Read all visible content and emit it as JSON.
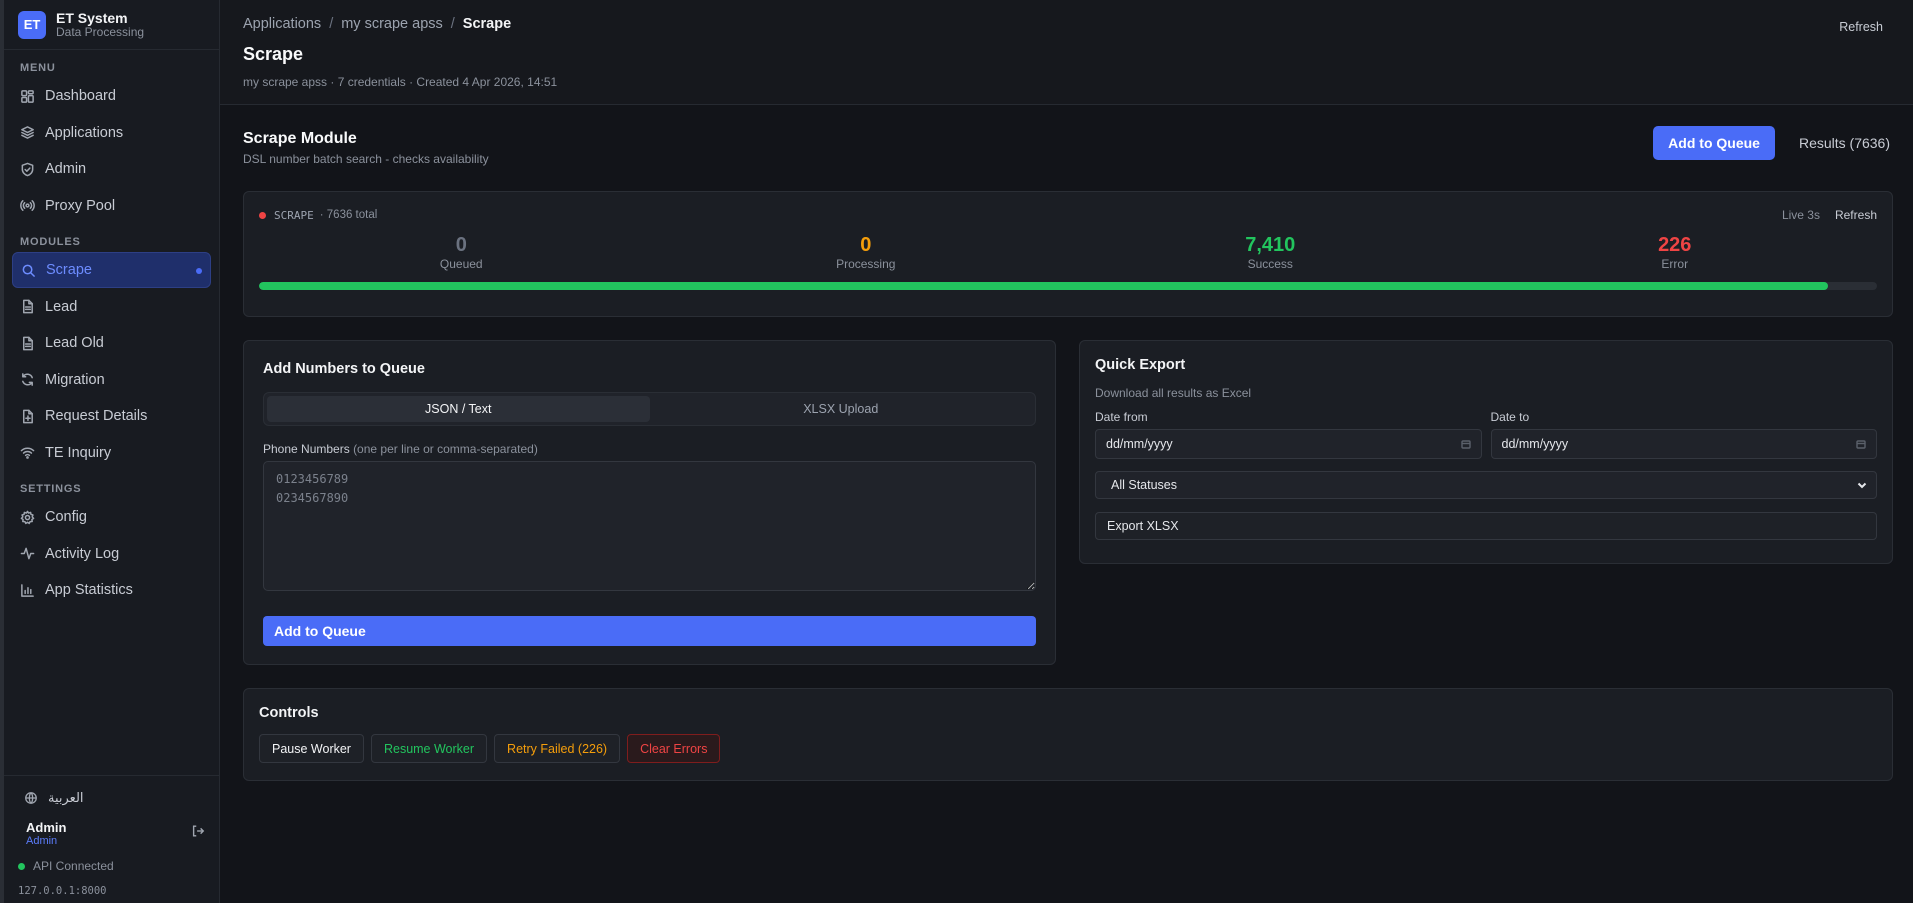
{
  "brand": {
    "logo": "ET",
    "title": "ET System",
    "subtitle": "Data Processing"
  },
  "sidebar": {
    "sections": {
      "menu": "MENU",
      "modules": "MODULES",
      "settings": "SETTINGS"
    },
    "menu_items": [
      {
        "label": "Dashboard",
        "icon": "grid-icon"
      },
      {
        "label": "Applications",
        "icon": "layers-icon"
      },
      {
        "label": "Admin",
        "icon": "shield-icon"
      },
      {
        "label": "Proxy Pool",
        "icon": "broadcast-icon"
      }
    ],
    "module_items": [
      {
        "label": "Scrape",
        "icon": "search-icon",
        "active": true
      },
      {
        "label": "Lead",
        "icon": "file-icon"
      },
      {
        "label": "Lead Old",
        "icon": "file-icon"
      },
      {
        "label": "Migration",
        "icon": "refresh-icon"
      },
      {
        "label": "Request Details",
        "icon": "file-plus-icon"
      },
      {
        "label": "TE Inquiry",
        "icon": "wifi-icon"
      }
    ],
    "settings_items": [
      {
        "label": "Config",
        "icon": "gear-icon"
      },
      {
        "label": "Activity Log",
        "icon": "activity-icon"
      },
      {
        "label": "App Statistics",
        "icon": "bar-chart-icon"
      }
    ],
    "language": "العربية",
    "user": {
      "name": "Admin",
      "role": "Admin"
    },
    "api_status": "API Connected",
    "api_host": "127.0.0.1:8000",
    "colors": {
      "accent": "#4a6cf7",
      "api_ok": "#22c55e"
    }
  },
  "header": {
    "breadcrumb": [
      "Applications",
      "my scrape apss",
      "Scrape"
    ],
    "breadcrumb_sep": "/",
    "title": "Scrape",
    "meta": "my scrape apss · 7 credentials · Created 4 Apr 2026, 14:51",
    "refresh": "Refresh"
  },
  "module": {
    "title": "Scrape Module",
    "subtitle": "DSL number batch search - checks availability",
    "add_to_queue": "Add to Queue",
    "results": "Results (7636)"
  },
  "stats": {
    "tag": "SCRAPE",
    "total": "· 7636 total",
    "live": "Live 3s",
    "refresh": "Refresh",
    "items": [
      {
        "value": "0",
        "label": "Queued",
        "color": "#6b7280"
      },
      {
        "value": "0",
        "label": "Processing",
        "color": "#f59e0b"
      },
      {
        "value": "7,410",
        "label": "Success",
        "color": "#22c55e"
      },
      {
        "value": "226",
        "label": "Error",
        "color": "#ef4444"
      }
    ],
    "progress_fraction": 0.97
  },
  "add_numbers": {
    "title": "Add Numbers to Queue",
    "tabs": [
      "JSON / Text",
      "XLSX Upload"
    ],
    "active_tab": 0,
    "field_label": "Phone Numbers",
    "field_hint": "(one per line or comma-separated)",
    "placeholder": "0123456789\n0234567890",
    "submit": "Add to Queue"
  },
  "export": {
    "title": "Quick Export",
    "subtitle": "Download all results as Excel",
    "date_from_label": "Date from",
    "date_to_label": "Date to",
    "date_placeholder": "dd/mm/yyyy",
    "status_selected": "All Statuses",
    "button": "Export XLSX"
  },
  "controls": {
    "title": "Controls",
    "pause": "Pause Worker",
    "resume": "Resume Worker",
    "retry": "Retry Failed (226)",
    "clear": "Clear Errors"
  }
}
